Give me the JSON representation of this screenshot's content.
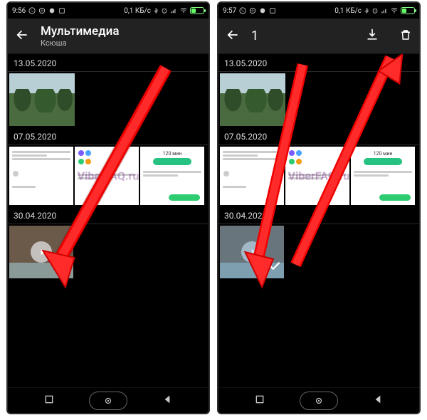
{
  "left": {
    "statusbar": {
      "time": "9:56",
      "net": "0,1 КБ/с"
    },
    "appbar": {
      "title": "Мультимедиа",
      "subtitle": "Ксюша"
    },
    "groups": [
      {
        "date": "13.05.2020"
      },
      {
        "date": "07.05.2020",
        "card3": "120 мин"
      },
      {
        "date": "30.04.2020"
      }
    ],
    "watermark": "ViberFAQ.ru"
  },
  "right": {
    "statusbar": {
      "time": "9:57",
      "net": "0,1 КБ/с"
    },
    "appbar": {
      "count": "1"
    },
    "groups": [
      {
        "date": "13.05.2020"
      },
      {
        "date": "07.05.2020",
        "card3": "120 мин"
      },
      {
        "date": "30.04.2020"
      }
    ],
    "watermark": "ViberFAQ.ru"
  }
}
